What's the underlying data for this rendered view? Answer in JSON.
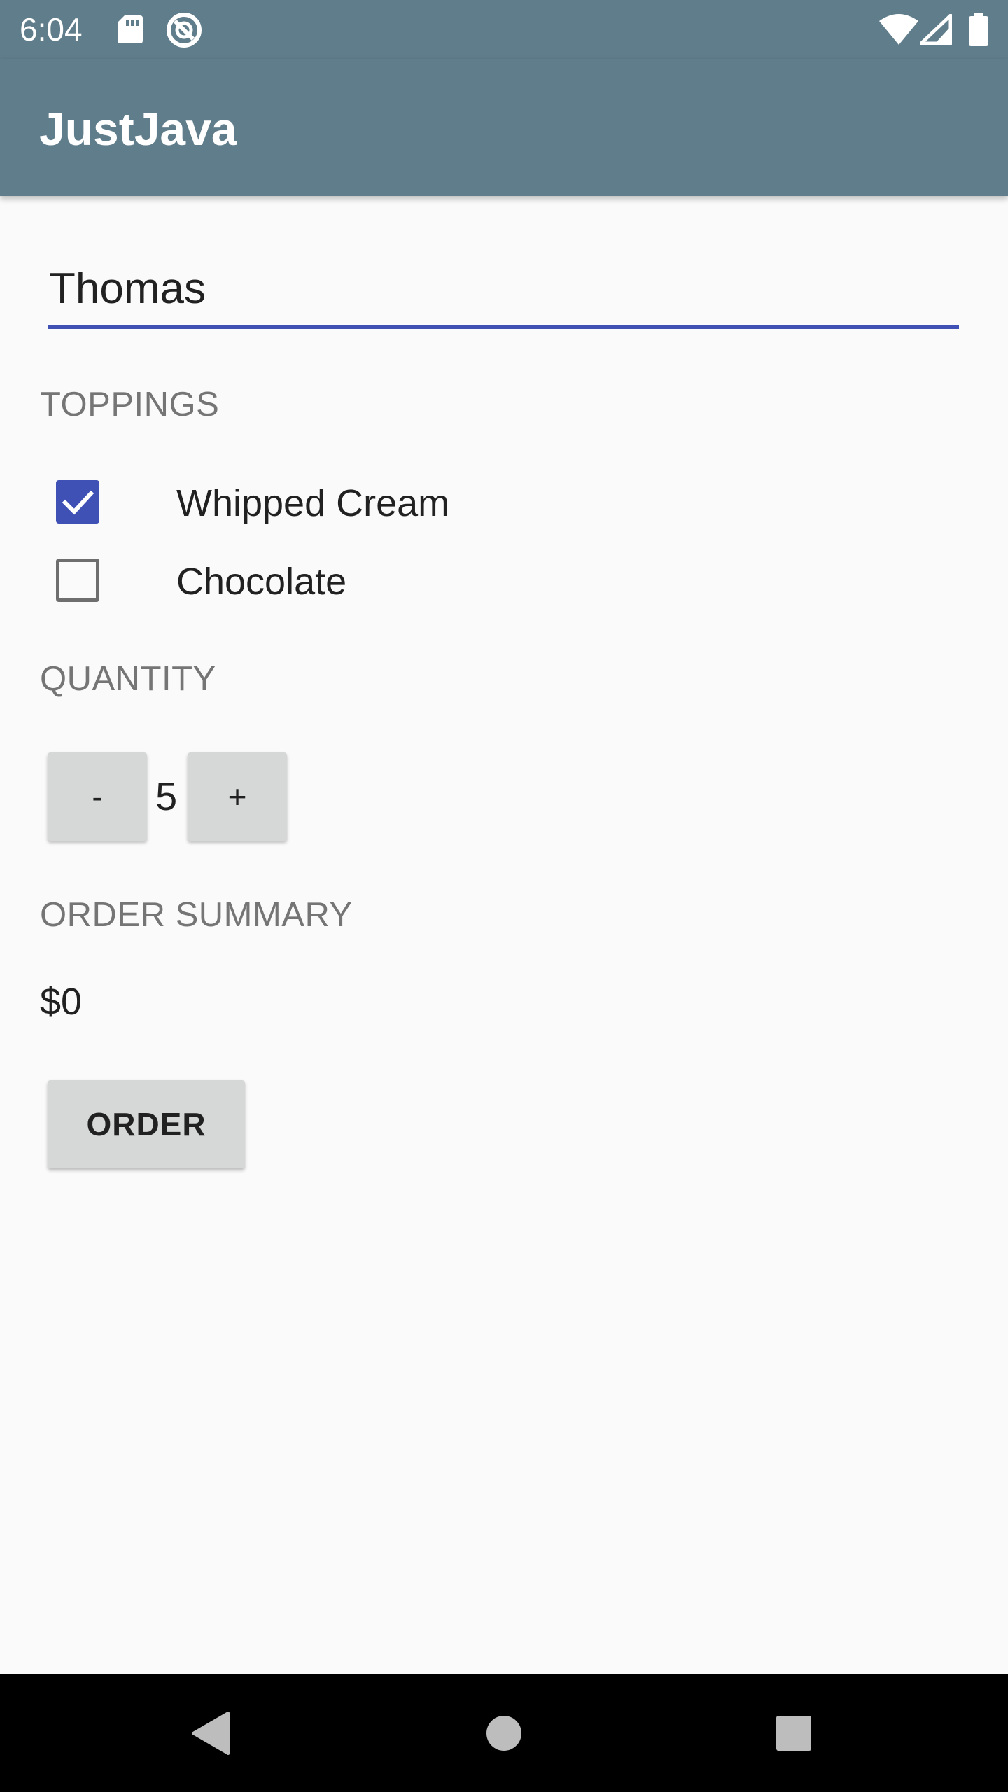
{
  "status_bar": {
    "time": "6:04",
    "icons": [
      "sd-card-icon",
      "sync-icon",
      "wifi-icon",
      "signal-icon",
      "battery-icon"
    ]
  },
  "app_bar": {
    "title": "JustJava"
  },
  "form": {
    "name_value": "Thomas",
    "toppings_label": "TOPPINGS",
    "toppings": [
      {
        "label": "Whipped Cream",
        "checked": true
      },
      {
        "label": "Chocolate",
        "checked": false
      }
    ],
    "quantity_label": "QUANTITY",
    "quantity": {
      "decrement_label": "-",
      "value": "5",
      "increment_label": "+"
    },
    "order_summary_label": "ORDER SUMMARY",
    "order_summary_value": "$0",
    "order_button_label": "ORDER"
  },
  "nav_bar": {
    "buttons": [
      "back-icon",
      "home-icon",
      "recents-icon"
    ]
  },
  "colors": {
    "app_bar": "#607d8b",
    "accent": "#3f51b5",
    "background": "#fafafa",
    "button": "#d6d7d7"
  }
}
